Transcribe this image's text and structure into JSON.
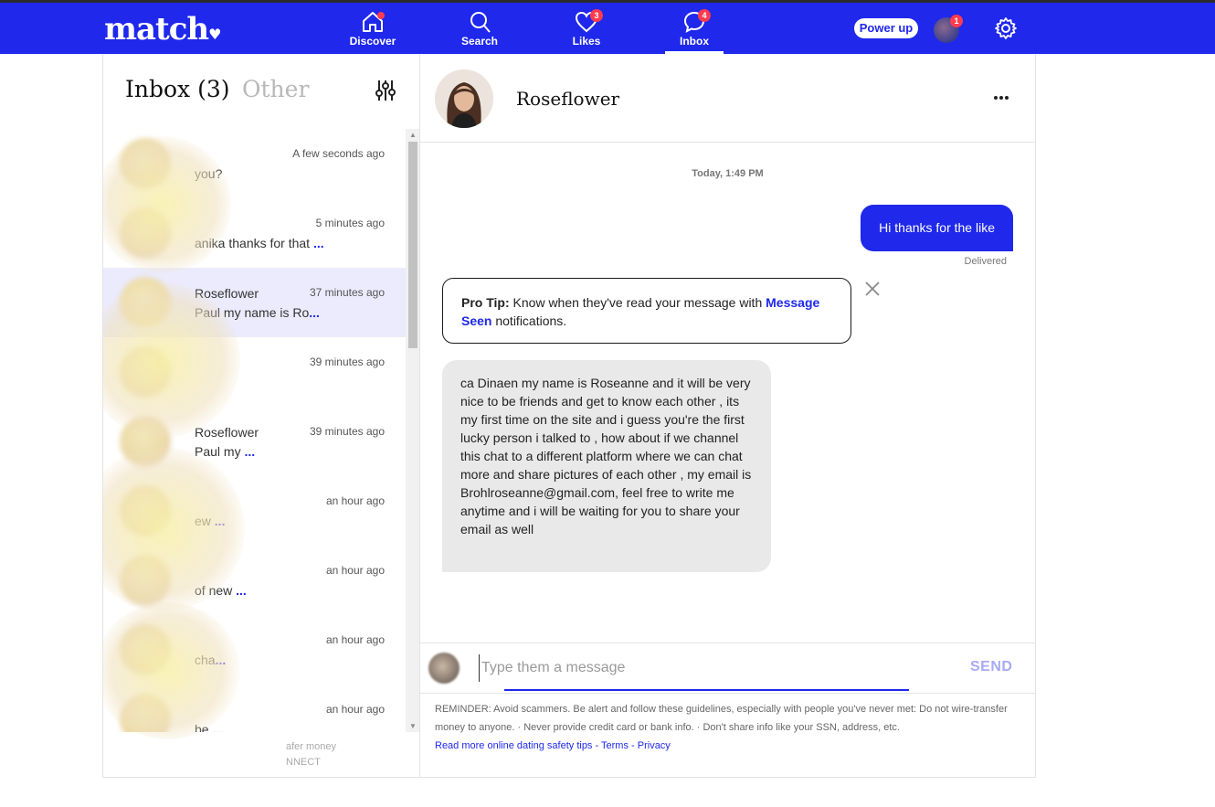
{
  "nav": {
    "logo": "match",
    "items": [
      {
        "label": "Discover",
        "badge": ""
      },
      {
        "label": "Search",
        "badge": ""
      },
      {
        "label": "Likes",
        "badge": "3"
      },
      {
        "label": "Inbox",
        "badge": "4"
      }
    ],
    "power_up": "Power up",
    "avatar_badge": "1"
  },
  "inbox": {
    "tab_inbox": "Inbox (3)",
    "tab_other": "Other",
    "conversations": [
      {
        "name": "",
        "time": "A few seconds ago",
        "preview": "you?",
        "more": "",
        "active": false
      },
      {
        "name": "",
        "time": "5 minutes ago",
        "preview": "anika thanks for that",
        "more": "...",
        "active": false
      },
      {
        "name": "Roseflower",
        "time": "37 minutes ago",
        "preview": "Paul my name is Ro",
        "more": "...",
        "active": true
      },
      {
        "name": "",
        "time": "39 minutes ago",
        "preview": "",
        "more": "",
        "active": false
      },
      {
        "name": "Roseflower",
        "time": "39 minutes ago",
        "preview": "Paul my",
        "more": "...",
        "active": false
      },
      {
        "name": "",
        "time": "an hour ago",
        "preview": "ew",
        "more": "...",
        "active": false
      },
      {
        "name": "",
        "time": "an hour ago",
        "preview": "of new",
        "more": "...",
        "active": false
      },
      {
        "name": "",
        "time": "an hour ago",
        "preview": "cha",
        "more": "...",
        "active": false
      },
      {
        "name": "",
        "time": "an hour ago",
        "preview": "be",
        "more": "...",
        "active": false
      }
    ],
    "footer_remnant": "afer money",
    "footer_remnant2": "NNECT"
  },
  "chat": {
    "name": "Roseflower",
    "date": "Today, 1:49 PM",
    "sent_message": "Hi thanks for the like",
    "delivered": "Delivered",
    "protip_label": "Pro Tip:",
    "protip_text": "Know when they've read your message with",
    "protip_link": "Message Seen",
    "protip_suffix": "notifications.",
    "received_message": "ca Dinaen my name is Roseanne and it will be very nice to be friends and get to know each other , its my first time on the site and i guess you're the first lucky person i talked to , how about if we channel this chat to a different platform where we can chat more and share pictures of each other , my email is Brohlroseanne@gmail.com, feel free to write me anytime and i will be waiting for you to share your email as well",
    "input_placeholder": "Type them a message",
    "send_label": "SEND",
    "reminder": "REMINDER: Avoid scammers. Be alert and follow these guidelines, especially with people you've never met: Do not wire-transfer money to anyone. · Never provide credit card or bank info. · Don't share info like your SSN, address, etc.",
    "link_safety": "Read more online dating safety tips",
    "link_terms": "Terms",
    "link_privacy": "Privacy",
    "sep": " - "
  },
  "colors": {
    "brand": "#1f28eb",
    "badge": "#ff3b4e"
  }
}
